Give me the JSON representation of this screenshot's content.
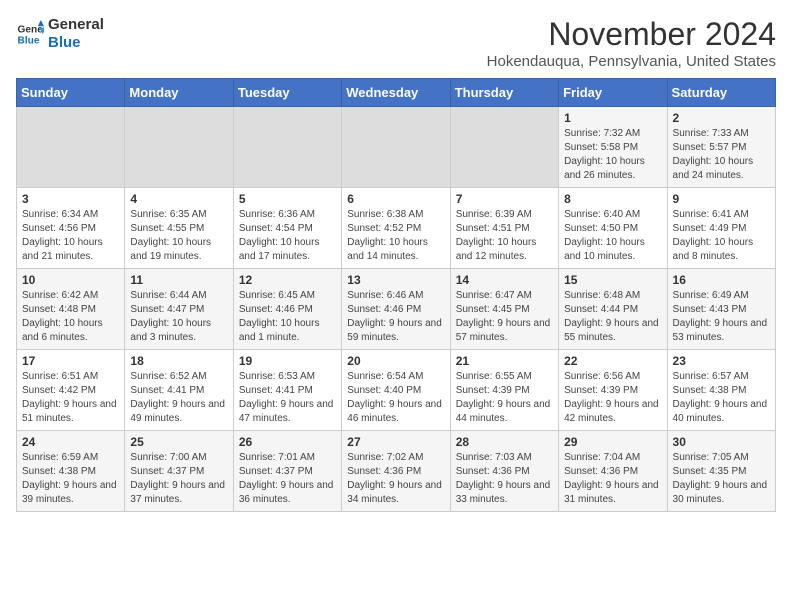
{
  "logo": {
    "line1": "General",
    "line2": "Blue"
  },
  "title": "November 2024",
  "subtitle": "Hokendauqua, Pennsylvania, United States",
  "days_of_week": [
    "Sunday",
    "Monday",
    "Tuesday",
    "Wednesday",
    "Thursday",
    "Friday",
    "Saturday"
  ],
  "weeks": [
    [
      {
        "day": "",
        "info": ""
      },
      {
        "day": "",
        "info": ""
      },
      {
        "day": "",
        "info": ""
      },
      {
        "day": "",
        "info": ""
      },
      {
        "day": "",
        "info": ""
      },
      {
        "day": "1",
        "info": "Sunrise: 7:32 AM\nSunset: 5:58 PM\nDaylight: 10 hours and 26 minutes."
      },
      {
        "day": "2",
        "info": "Sunrise: 7:33 AM\nSunset: 5:57 PM\nDaylight: 10 hours and 24 minutes."
      }
    ],
    [
      {
        "day": "3",
        "info": "Sunrise: 6:34 AM\nSunset: 4:56 PM\nDaylight: 10 hours and 21 minutes."
      },
      {
        "day": "4",
        "info": "Sunrise: 6:35 AM\nSunset: 4:55 PM\nDaylight: 10 hours and 19 minutes."
      },
      {
        "day": "5",
        "info": "Sunrise: 6:36 AM\nSunset: 4:54 PM\nDaylight: 10 hours and 17 minutes."
      },
      {
        "day": "6",
        "info": "Sunrise: 6:38 AM\nSunset: 4:52 PM\nDaylight: 10 hours and 14 minutes."
      },
      {
        "day": "7",
        "info": "Sunrise: 6:39 AM\nSunset: 4:51 PM\nDaylight: 10 hours and 12 minutes."
      },
      {
        "day": "8",
        "info": "Sunrise: 6:40 AM\nSunset: 4:50 PM\nDaylight: 10 hours and 10 minutes."
      },
      {
        "day": "9",
        "info": "Sunrise: 6:41 AM\nSunset: 4:49 PM\nDaylight: 10 hours and 8 minutes."
      }
    ],
    [
      {
        "day": "10",
        "info": "Sunrise: 6:42 AM\nSunset: 4:48 PM\nDaylight: 10 hours and 6 minutes."
      },
      {
        "day": "11",
        "info": "Sunrise: 6:44 AM\nSunset: 4:47 PM\nDaylight: 10 hours and 3 minutes."
      },
      {
        "day": "12",
        "info": "Sunrise: 6:45 AM\nSunset: 4:46 PM\nDaylight: 10 hours and 1 minute."
      },
      {
        "day": "13",
        "info": "Sunrise: 6:46 AM\nSunset: 4:46 PM\nDaylight: 9 hours and 59 minutes."
      },
      {
        "day": "14",
        "info": "Sunrise: 6:47 AM\nSunset: 4:45 PM\nDaylight: 9 hours and 57 minutes."
      },
      {
        "day": "15",
        "info": "Sunrise: 6:48 AM\nSunset: 4:44 PM\nDaylight: 9 hours and 55 minutes."
      },
      {
        "day": "16",
        "info": "Sunrise: 6:49 AM\nSunset: 4:43 PM\nDaylight: 9 hours and 53 minutes."
      }
    ],
    [
      {
        "day": "17",
        "info": "Sunrise: 6:51 AM\nSunset: 4:42 PM\nDaylight: 9 hours and 51 minutes."
      },
      {
        "day": "18",
        "info": "Sunrise: 6:52 AM\nSunset: 4:41 PM\nDaylight: 9 hours and 49 minutes."
      },
      {
        "day": "19",
        "info": "Sunrise: 6:53 AM\nSunset: 4:41 PM\nDaylight: 9 hours and 47 minutes."
      },
      {
        "day": "20",
        "info": "Sunrise: 6:54 AM\nSunset: 4:40 PM\nDaylight: 9 hours and 46 minutes."
      },
      {
        "day": "21",
        "info": "Sunrise: 6:55 AM\nSunset: 4:39 PM\nDaylight: 9 hours and 44 minutes."
      },
      {
        "day": "22",
        "info": "Sunrise: 6:56 AM\nSunset: 4:39 PM\nDaylight: 9 hours and 42 minutes."
      },
      {
        "day": "23",
        "info": "Sunrise: 6:57 AM\nSunset: 4:38 PM\nDaylight: 9 hours and 40 minutes."
      }
    ],
    [
      {
        "day": "24",
        "info": "Sunrise: 6:59 AM\nSunset: 4:38 PM\nDaylight: 9 hours and 39 minutes."
      },
      {
        "day": "25",
        "info": "Sunrise: 7:00 AM\nSunset: 4:37 PM\nDaylight: 9 hours and 37 minutes."
      },
      {
        "day": "26",
        "info": "Sunrise: 7:01 AM\nSunset: 4:37 PM\nDaylight: 9 hours and 36 minutes."
      },
      {
        "day": "27",
        "info": "Sunrise: 7:02 AM\nSunset: 4:36 PM\nDaylight: 9 hours and 34 minutes."
      },
      {
        "day": "28",
        "info": "Sunrise: 7:03 AM\nSunset: 4:36 PM\nDaylight: 9 hours and 33 minutes."
      },
      {
        "day": "29",
        "info": "Sunrise: 7:04 AM\nSunset: 4:36 PM\nDaylight: 9 hours and 31 minutes."
      },
      {
        "day": "30",
        "info": "Sunrise: 7:05 AM\nSunset: 4:35 PM\nDaylight: 9 hours and 30 minutes."
      }
    ]
  ]
}
